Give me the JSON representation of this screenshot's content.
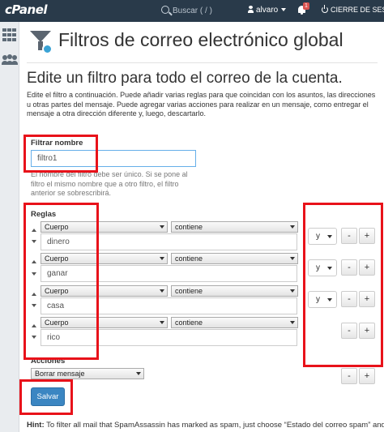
{
  "topbar": {
    "logo": "cPanel",
    "search_placeholder": "Buscar ( / )",
    "user": "alvaro",
    "notif_count": "1",
    "logout": "CIERRE DE SESIÓN"
  },
  "page": {
    "title": "Filtros de correo electrónico global",
    "subtitle": "Edite un filtro para todo el correo de la cuenta.",
    "description": "Edite el filtro a continuación. Puede añadir varias reglas para que coincidan con los asuntos, las direcciones u otras partes del mensaje. Puede agregar varias acciones para realizar en un mensaje, como entregar el mensaje a otra dirección diferente y, luego, descartarlo."
  },
  "filter": {
    "label": "Filtrar nombre",
    "value": "filtro1",
    "help": "El nombre del filtro debe ser único. Si se pone al filtro el mismo nombre que a otro filtro, el filtro anterior se sobrescribirá."
  },
  "rules": {
    "label": "Reglas",
    "items": [
      {
        "field": "Cuerpo",
        "op": "contiene",
        "value": "dinero",
        "connector": "y"
      },
      {
        "field": "Cuerpo",
        "op": "contiene",
        "value": "ganar",
        "connector": "y"
      },
      {
        "field": "Cuerpo",
        "op": "contiene",
        "value": "casa",
        "connector": "y"
      },
      {
        "field": "Cuerpo",
        "op": "contiene",
        "value": "rico",
        "connector": ""
      }
    ],
    "minus": "-",
    "plus": "+"
  },
  "actions": {
    "label": "Acciones",
    "selected": "Borrar mensaje"
  },
  "save_label": "Salvar",
  "hint": {
    "label": "Hint:",
    "text": " To filter all mail that SpamAssassin has marked as spam, just choose “Estado del correo spam” and c"
  },
  "colors": {
    "topbar": "#293a4a",
    "highlight": "#e8121a",
    "primary_button": "#3b86c2"
  }
}
